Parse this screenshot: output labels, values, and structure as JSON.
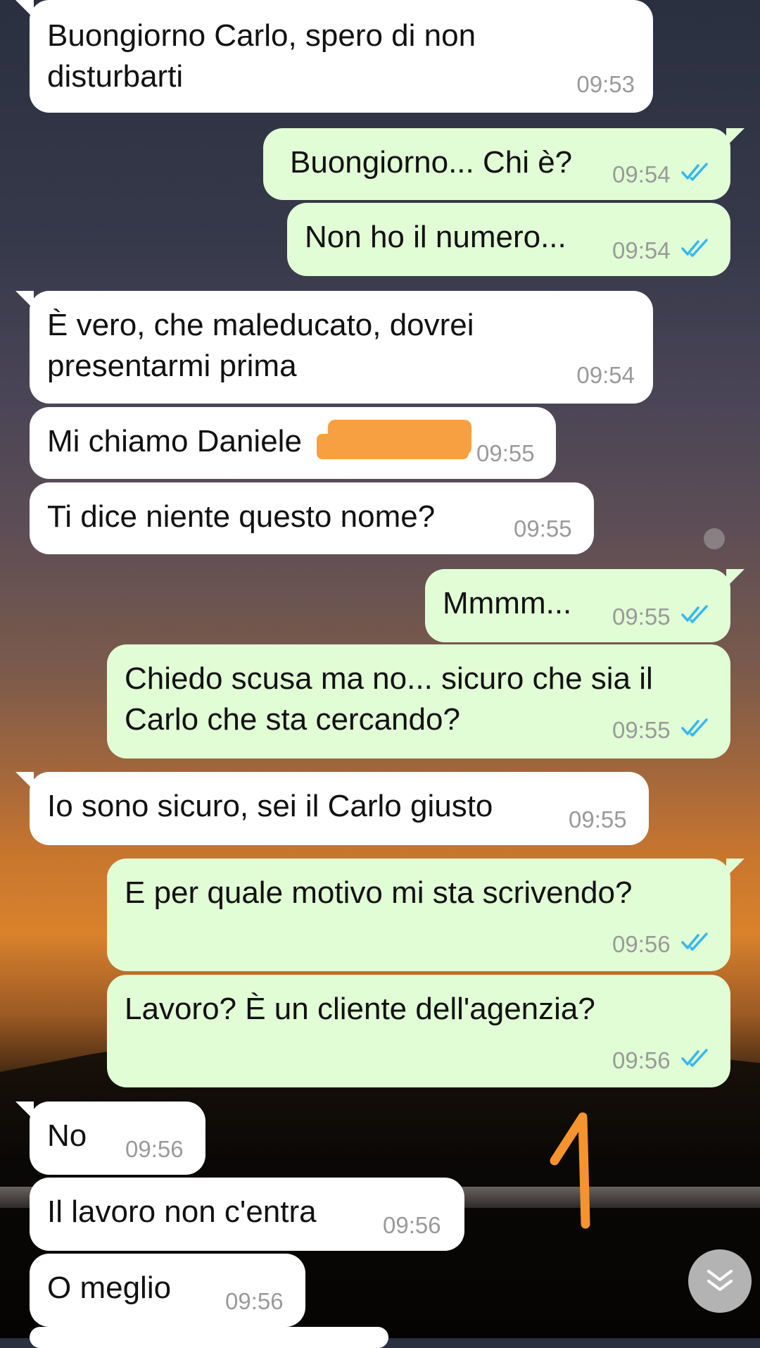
{
  "colors": {
    "incoming_bubble": "#ffffff",
    "outgoing_bubble": "#e1fdd5",
    "timestamp": "#9a9a9a",
    "read_ticks": "#34b7f1",
    "redaction": "#f7a041",
    "annotation": "#f5932e"
  },
  "messages": [
    {
      "dir": "in",
      "text": "Buongiorno Carlo, spero di non\ndisturbarti",
      "time": "09:53"
    },
    {
      "dir": "out",
      "text": "Buongiorno... Chi è?",
      "time": "09:54",
      "status": "read-ticks-icon"
    },
    {
      "dir": "out",
      "text": "Non ho il numero...",
      "time": "09:54",
      "status": "read-ticks-icon"
    },
    {
      "dir": "in",
      "text": "È vero, che maleducato, dovrei\npresentarmi prima",
      "time": "09:54"
    },
    {
      "dir": "in",
      "text": "Mi chiamo Daniele",
      "time": "09:55",
      "redacted": true
    },
    {
      "dir": "in",
      "text": "Ti dice niente questo nome?",
      "time": "09:55"
    },
    {
      "dir": "out",
      "text": "Mmmm...",
      "time": "09:55",
      "status": "read-ticks-icon"
    },
    {
      "dir": "out",
      "text": "Chiedo scusa ma no... sicuro che sia il\nCarlo che sta cercando?",
      "time": "09:55",
      "status": "read-ticks-icon"
    },
    {
      "dir": "in",
      "text": "Io sono sicuro, sei il Carlo giusto",
      "time": "09:55"
    },
    {
      "dir": "out",
      "text": "E per quale motivo mi sta scrivendo?",
      "time": "09:56",
      "status": "read-ticks-icon"
    },
    {
      "dir": "out",
      "text": "Lavoro? È un cliente dell'agenzia?",
      "time": "09:56",
      "status": "read-ticks-icon"
    },
    {
      "dir": "in",
      "text": "No",
      "time": "09:56"
    },
    {
      "dir": "in",
      "text": "Il lavoro non c'entra",
      "time": "09:56"
    },
    {
      "dir": "in",
      "text": "O meglio",
      "time": "09:56"
    }
  ],
  "annotation": {
    "text": "1",
    "icon": "handwritten-number-one"
  },
  "scroll_button": {
    "icon": "double-chevron-down-icon"
  }
}
